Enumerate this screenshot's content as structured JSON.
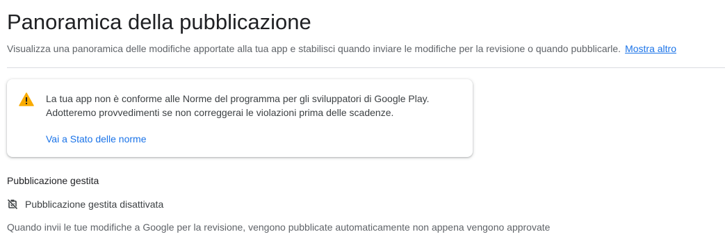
{
  "header": {
    "title": "Panoramica della pubblicazione",
    "subtitle": "Visualizza una panoramica delle modifiche apportate alla tua app e stabilisci quando inviare le modifiche per la revisione o quando pubblicarle.",
    "more_link": "Mostra altro"
  },
  "warning": {
    "icon": "warning-triangle-icon",
    "icon_color": "#f9ab00",
    "line1": "La tua app non è conforme alle Norme del programma per gli sviluppatori di Google Play.",
    "line2": "Adotteremo provvedimenti se non correggerai le violazioni prima delle scadenze.",
    "link": "Vai a Stato delle norme"
  },
  "managed_publishing": {
    "heading": "Pubblicazione gestita",
    "status_icon": "managed-publishing-off-icon",
    "status": "Pubblicazione gestita disattivata",
    "description": "Quando invii le tue modifiche a Google per la revisione, vengono pubblicate automaticamente non appena vengono approvate"
  },
  "colors": {
    "link": "#1a73e8",
    "text_primary": "#202124",
    "text_secondary": "#5f6368"
  }
}
